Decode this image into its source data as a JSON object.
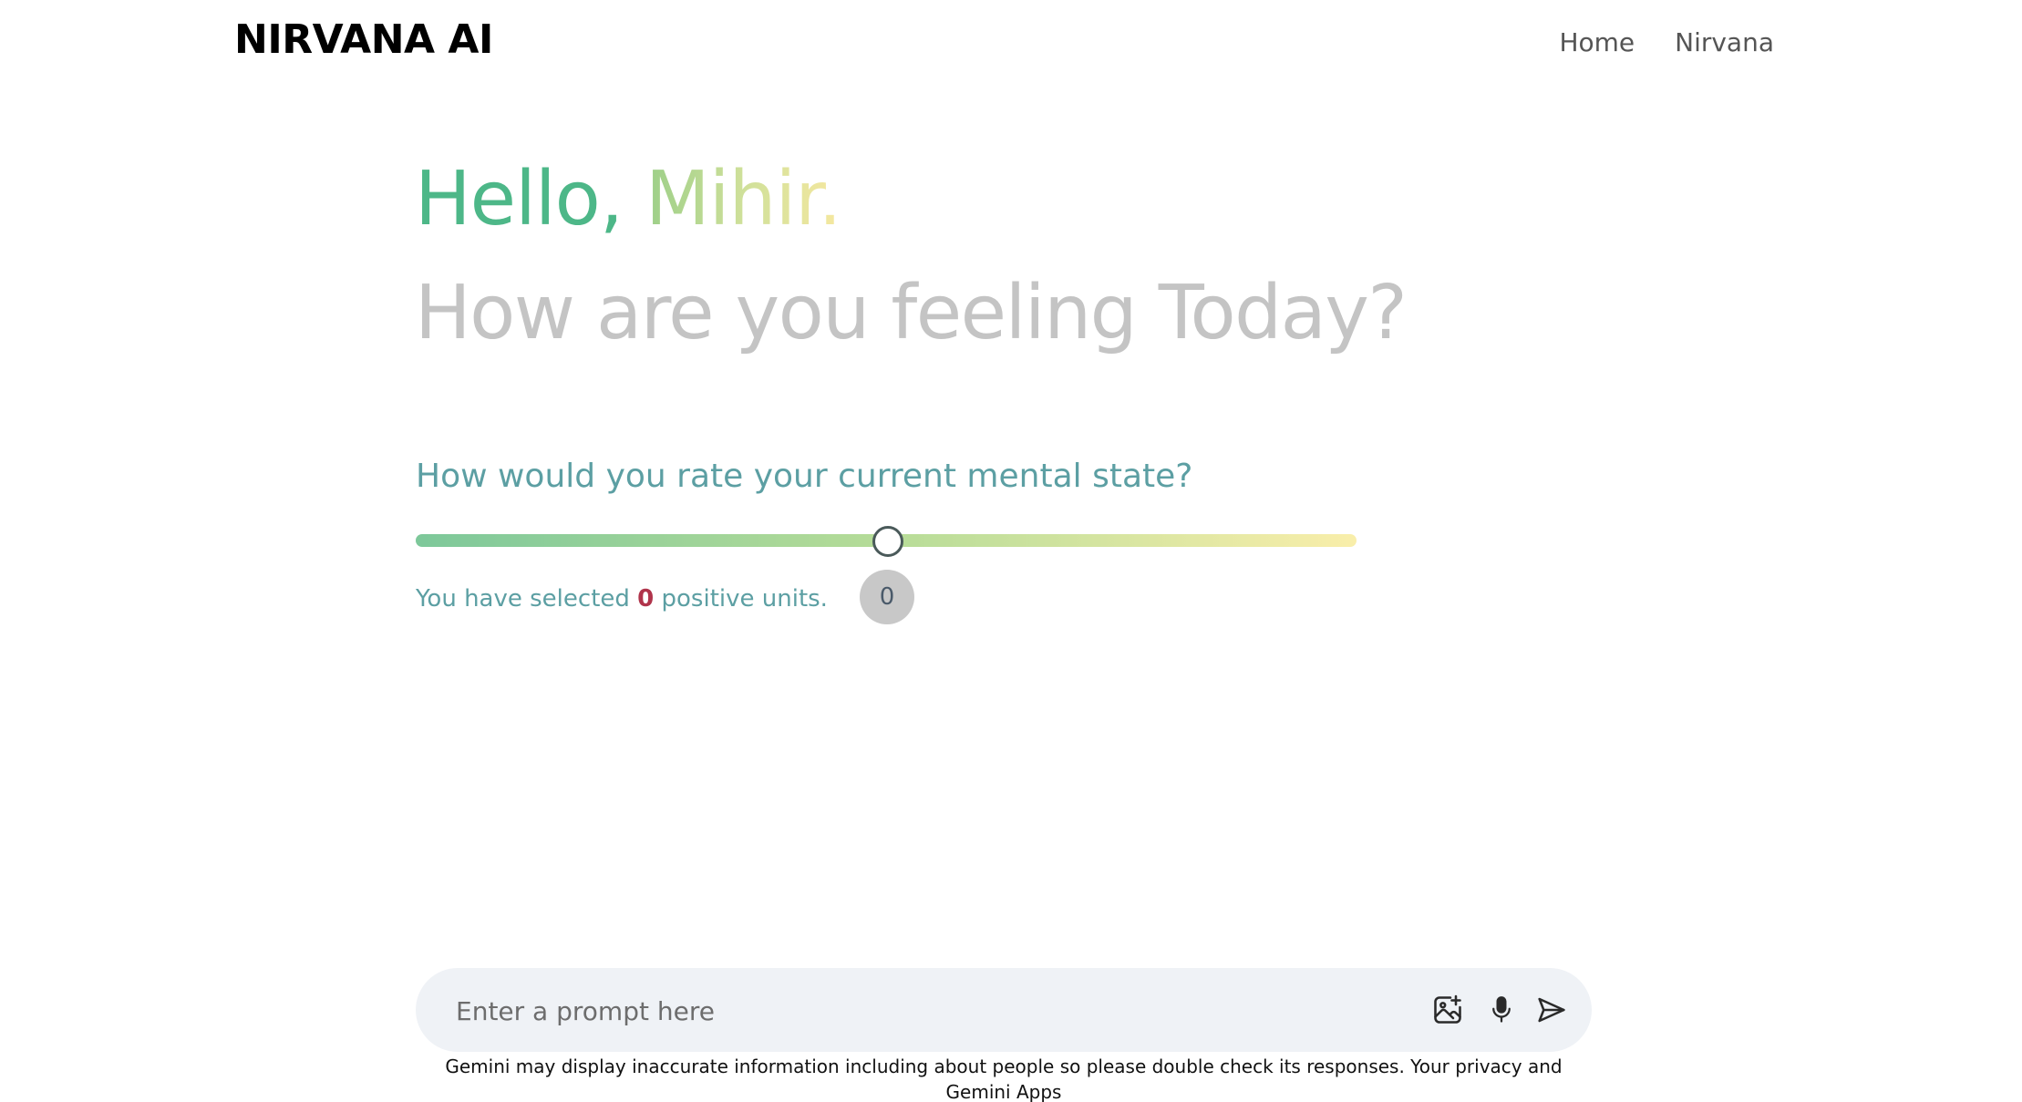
{
  "header": {
    "brand": "NIRVANA AI",
    "nav": [
      {
        "label": "Home"
      },
      {
        "label": "Nirvana"
      }
    ]
  },
  "greeting": {
    "hello": "Hello, ",
    "name": "Mihir.",
    "subtitle": "How are you feeling Today?"
  },
  "rating": {
    "question": "How would you rate your current mental state?",
    "slider_value": 0,
    "selected_prefix": "You have selected ",
    "selected_value": "0",
    "selected_suffix": " positive units.",
    "bubble_value": "0"
  },
  "prompt": {
    "placeholder": "Enter a prompt here",
    "icons": [
      "add-image-icon",
      "microphone-icon",
      "send-icon"
    ]
  },
  "disclaimer": "Gemini may display inaccurate information including about people so please double check its responses. Your privacy and Gemini Apps",
  "colors": {
    "hello": "#4db788",
    "name_gradient_start": "#9ccf88",
    "name_gradient_end": "#f6e8a0",
    "subtitle": "#c4c4c4",
    "question": "#5c9fa3",
    "selected_number": "#b0344b",
    "slider_start": "#7dc89a",
    "slider_end": "#f9eeaa",
    "prompt_bg": "#eff2f6"
  }
}
